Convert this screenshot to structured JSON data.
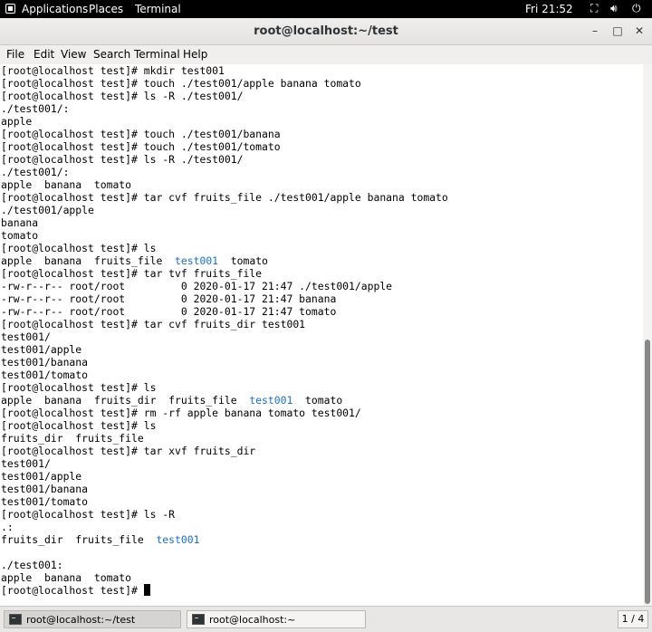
{
  "topbar": {
    "applications": "Applications",
    "places": "Places",
    "terminal": "Terminal",
    "clock": "Fri 21:52",
    "icons": [
      "network-icon",
      "volume-icon",
      "power-icon"
    ]
  },
  "window": {
    "title": "root@localhost:~/test",
    "minimize": "–",
    "maximize": "□",
    "close": "✕"
  },
  "menubar": [
    "File",
    "Edit",
    "View",
    "Search",
    "Terminal",
    "Help"
  ],
  "terminal": {
    "lines": [
      "[root@localhost test]# mkdir test001",
      "[root@localhost test]# touch ./test001/apple banana tomato",
      "[root@localhost test]# ls -R ./test001/",
      "./test001/:",
      "apple",
      "[root@localhost test]# touch ./test001/banana",
      "[root@localhost test]# touch ./test001/tomato",
      "[root@localhost test]# ls -R ./test001/",
      "./test001/:",
      "apple  banana  tomato",
      "[root@localhost test]# tar cvf fruits_file ./test001/apple banana tomato",
      "./test001/apple",
      "banana",
      "tomato",
      "[root@localhost test]# ls",
      "",
      "[root@localhost test]# tar tvf fruits_file",
      "-rw-r--r-- root/root         0 2020-01-17 21:47 ./test001/apple",
      "-rw-r--r-- root/root         0 2020-01-17 21:47 banana",
      "-rw-r--r-- root/root         0 2020-01-17 21:47 tomato",
      "[root@localhost test]# tar cvf fruits_dir test001",
      "test001/",
      "test001/apple",
      "test001/banana",
      "test001/tomato",
      "[root@localhost test]# ls",
      "",
      "[root@localhost test]# rm -rf apple banana tomato test001/",
      "[root@localhost test]# ls",
      "fruits_dir  fruits_file",
      "[root@localhost test]# tar xvf fruits_dir",
      "test001/",
      "test001/apple",
      "test001/banana",
      "test001/tomato",
      "[root@localhost test]# ls -R",
      ".:",
      "",
      "",
      "./test001:",
      "apple  banana  tomato",
      ""
    ],
    "ls1_before": "apple  banana  fruits_file  ",
    "ls1_dir": "test001",
    "ls1_after": "  tomato",
    "ls2_before": "apple  banana  fruits_dir  fruits_file  ",
    "ls2_dir": "test001",
    "ls2_after": "  tomato",
    "ls3_before": "fruits_dir  fruits_file  ",
    "ls3_dir": "test001",
    "prompt": "[root@localhost test]# "
  },
  "taskbar": {
    "task1": "root@localhost:~/test",
    "task2": "root@localhost:~",
    "pager": "1 / 4"
  }
}
